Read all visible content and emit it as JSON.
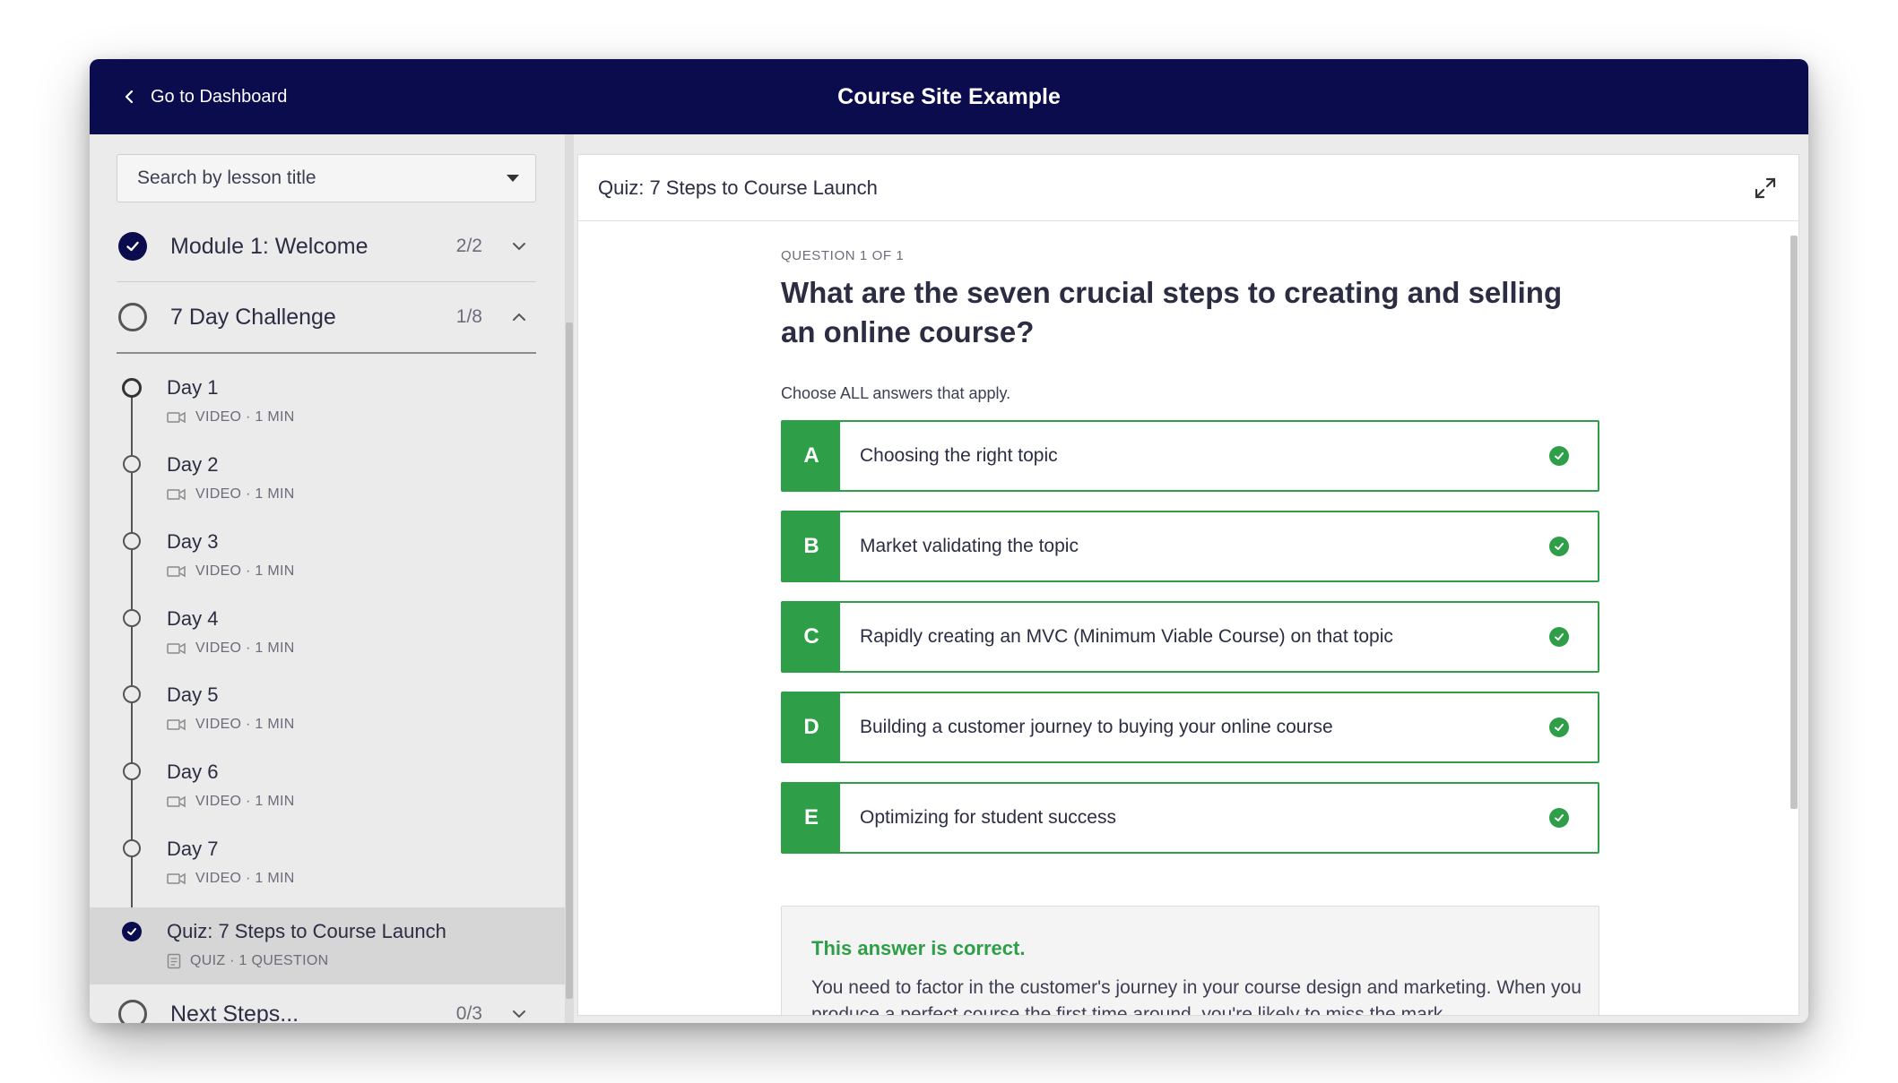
{
  "header": {
    "back_label": "Go to Dashboard",
    "site_title": "Course Site Example"
  },
  "sidebar": {
    "search_placeholder": "Search by lesson title",
    "modules": [
      {
        "title": "Module 1: Welcome",
        "count": "2/2",
        "status": "complete",
        "expanded": false
      },
      {
        "title": "7 Day Challenge",
        "count": "1/8",
        "status": "in-progress",
        "expanded": true
      },
      {
        "title": "Next Steps...",
        "count": "0/3",
        "status": "in-progress",
        "expanded": false
      }
    ],
    "lessons": [
      {
        "name": "Day 1",
        "meta": "VIDEO · 1 MIN"
      },
      {
        "name": "Day 2",
        "meta": "VIDEO · 1 MIN"
      },
      {
        "name": "Day 3",
        "meta": "VIDEO · 1 MIN"
      },
      {
        "name": "Day 4",
        "meta": "VIDEO · 1 MIN"
      },
      {
        "name": "Day 5",
        "meta": "VIDEO · 1 MIN"
      },
      {
        "name": "Day 6",
        "meta": "VIDEO · 1 MIN"
      },
      {
        "name": "Day 7",
        "meta": "VIDEO · 1 MIN"
      },
      {
        "name": "Quiz: 7 Steps to Course Launch",
        "meta": "QUIZ · 1 QUESTION",
        "active": true
      }
    ]
  },
  "content": {
    "title": "Quiz: 7 Steps to Course Launch",
    "question_counter": "QUESTION 1 OF 1",
    "question": "What are the seven crucial steps to creating and selling an online course?",
    "instructions": "Choose ALL answers that apply.",
    "answers": [
      {
        "letter": "A",
        "text": "Choosing the right topic"
      },
      {
        "letter": "B",
        "text": "Market validating the topic"
      },
      {
        "letter": "C",
        "text": "Rapidly creating an MVC (Minimum Viable Course) on that topic"
      },
      {
        "letter": "D",
        "text": "Building a customer journey to buying your online course"
      },
      {
        "letter": "E",
        "text": "Optimizing for student success"
      }
    ],
    "feedback": {
      "heading": "This answer is correct.",
      "body": "You need to factor in the customer's journey in your course design and marketing. When you produce a perfect course the first time around, you're likely to miss the mark."
    }
  },
  "colors": {
    "header_bg": "#0b0c4d",
    "correct_green": "#2e9e48",
    "sidebar_bg": "#ebebeb"
  }
}
